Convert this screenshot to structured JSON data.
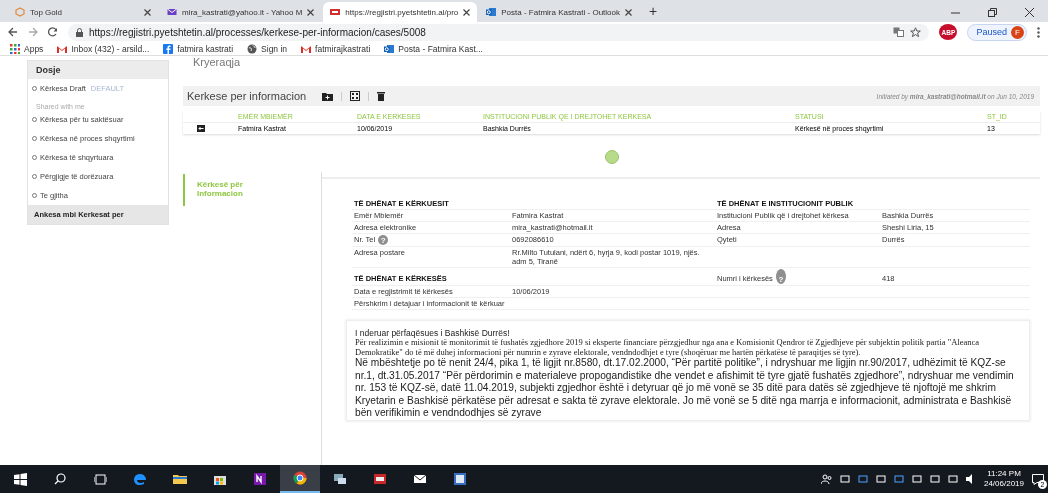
{
  "browser": {
    "tabs": [
      {
        "title": "Top Gold",
        "kind": "cube",
        "selected": false
      },
      {
        "title": "mira_kastrati@yahoo.it - Yahoo M",
        "kind": "mail",
        "selected": false
      },
      {
        "title": "https://regjistri.pyetshtetin.al/pro",
        "kind": "site",
        "selected": true
      },
      {
        "title": "Posta - Fatmira Kastrati - Outlook",
        "kind": "outlook",
        "selected": false
      }
    ],
    "new_tab": "+",
    "url": "https://regjistri.pyetshtetin.al/processes/kerkese-per-informacion/cases/5008",
    "adblock": "ABP",
    "profile_status": "Paused",
    "profile_initial": "F",
    "bookmarks": [
      {
        "label": "Apps",
        "kind": "apps"
      },
      {
        "label": "Inbox (432) - arsild...",
        "kind": "gmail"
      },
      {
        "label": "fatmira kastrati",
        "kind": "facebook"
      },
      {
        "label": "Sign in",
        "kind": "globe"
      },
      {
        "label": "fatmirajkastrati",
        "kind": "gmail"
      },
      {
        "label": "Posta - Fatmira Kast...",
        "kind": "outlook"
      }
    ]
  },
  "sidebar": {
    "title": "Dosje",
    "draft": {
      "label": "Kërkesa Draft",
      "badge": "DEFAULT"
    },
    "section": "Shared with me",
    "items": [
      "Kërkesa për tu saktësuar",
      "Kërkesa në proces shqyrtimi",
      "Kërkesa të shqyrtuara",
      "Përgjigje të dorëzuara",
      "Te gjitha"
    ],
    "footer": "Ankesa mbi Kerkesat per"
  },
  "heading": "Kryeraqja",
  "case": {
    "title": "Kerkese per informacion",
    "initiated": "Initiated by **mira_kastrati@hotmail.it** on Jun 10, 2019",
    "columns": [
      "EMËR MBIEMËR",
      "DATA E KERKESES",
      "INSTITUCIONI PUBLIK QE I DREJTOHET KERKESA",
      "STATUSI",
      "ST_ID"
    ],
    "rows": [
      {
        "cells": [
          "Fatmira Kastrat",
          "10/06/2019",
          "Bashkia Durrës",
          "Kërkesë në proces shqyrtimi",
          "13"
        ]
      }
    ]
  },
  "form": {
    "tab": "Kërkesë për Informacion",
    "rows": [
      {
        "kind": "heading",
        "left": "TË DHËNAT E KËRKUESIT",
        "right": "TË DHËNAT E INSTITUCIONIT PUBLIK"
      },
      {
        "kind": "field",
        "label": "Emër Mbiemër",
        "value": "Fatmira Kastrat",
        "right_label": "Institucioni Publik që i drejtohet kërkesa",
        "right_value": "Bashkia Durrës"
      },
      {
        "kind": "field",
        "label": "Adresa elektronike",
        "value": "mira_kastrati@hotmail.it",
        "right_label": "Adresa",
        "right_value": "Sheshi Liria, 15"
      },
      {
        "kind": "field",
        "label": "Nr. Tel",
        "help_left": "?",
        "value": "0692086610",
        "right_label": "Qyteti",
        "right_value": "Durrës"
      },
      {
        "kind": "field",
        "label": "Adresa postare",
        "value": "Rr.Milto Tutulani, ndërt 6, hyrja 9, kodi postar 1019, njës. adm 5, Tiranë"
      },
      {
        "kind": "heading",
        "left": "TË DHËNAT E KËRKESËS",
        "right_label": "Numri i kërkesës",
        "help_right": "?",
        "right_value": "418"
      },
      {
        "kind": "field",
        "label": "Data e regjistrimit të kërkesës",
        "value": "10/06/2019"
      },
      {
        "kind": "field",
        "label": "Përshkrim i detajuar i informacionit të kërkuar"
      }
    ]
  },
  "letter": {
    "greeting": "I nderuar përfaqësues i Bashkisë Durrës!",
    "intro": "Për realizimin e misionit të monitorimit të fushatës zgjedhore 2019 si eksperte financiare përzgjedhur nga ana e Komisionit Qendror të Zgjedhjeve për subjektin politik partia \"Aleanca Demokratike\" do të më duhej informacioni për numrin e zyrave elektorale, vendndodhjet e tyre (shoqëruar me hartën përkatëse të paraqitjes së tyre).",
    "body": "Në mbështetje po të nenit 24/4, pika 1, të ligjit nr.8580, dt.17.02.2000, “Për partitë politike”, i ndryshuar me ligjin nr.90/2017, udhëzimit të KQZ-se nr.1, dt.31.05.2017 “Për përdorimin e materialeve propogandistike dhe vendet e afishimit të tyre gjatë fushatës zgjedhore”, ndryshuar me vendimin nr. 153 të KQZ-së, datë 11.04.2019, subjekti zgjedhor është i detyruar që jo më vonë se 35 ditë para datës së zgjedhjeve të njoftojë me shkrim Kryetarin e Bashkisë përkatëse për adresat e sakta të zyrave elektorale. Jo më vonë se 5 ditë nga marrja e informacionit, administrata e Bashkisë bën verifikimin e vendndodhjes së zyrave"
  },
  "taskbar": {
    "apps": [
      {
        "kind": "edge",
        "selected": false
      },
      {
        "kind": "folder",
        "selected": false
      },
      {
        "kind": "store",
        "selected": false
      },
      {
        "kind": "onenote",
        "selected": false
      },
      {
        "kind": "chrome",
        "selected": true
      },
      {
        "kind": "network",
        "selected": false
      },
      {
        "kind": "media",
        "selected": false
      },
      {
        "kind": "mail",
        "selected": false
      },
      {
        "kind": "doc",
        "selected": false
      }
    ],
    "time": "11:24 PM",
    "date": "24/06/2019",
    "notifications": "2"
  }
}
